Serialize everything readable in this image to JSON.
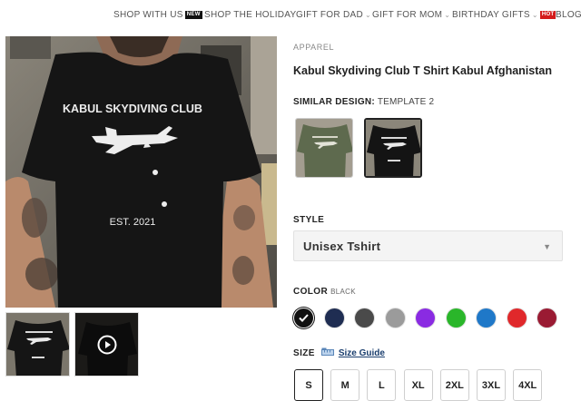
{
  "nav": {
    "items": [
      {
        "label": "SHOP WITH US",
        "badge": "NEW"
      },
      {
        "label": "SHOP THE HOLIDAY"
      },
      {
        "label": "GIFT FOR DAD",
        "chevron": "chevron-down-icon"
      },
      {
        "label": "GIFT FOR MOM",
        "chevron": "chevron-down-icon"
      },
      {
        "label": "BIRTHDAY GIFTS",
        "chevron": "chevron-down-icon",
        "badge": "HOT"
      },
      {
        "label": "BLOG"
      }
    ]
  },
  "product": {
    "category": "APPAREL",
    "title": "Kabul Skydiving Club T Shirt Kabul Afghanistan",
    "shirt_text_top": "KABUL SKYDIVING CLUB",
    "shirt_text_bottom": "EST. 2021",
    "similar_design_label": "SIMILAR DESIGN:",
    "similar_design_value": "TEMPLATE 2",
    "style_label": "STYLE",
    "style_value": "Unisex Tshirt",
    "color_label": "COLOR",
    "color_value": "BLACK",
    "colors": [
      "#111111",
      "#1f2d52",
      "#4a4a4a",
      "#9b9b9b",
      "#8a2be2",
      "#2ab62a",
      "#1f78c8",
      "#e0282b",
      "#9a1b33"
    ],
    "size_label": "SIZE",
    "size_guide": "Size Guide",
    "sizes": [
      "S",
      "M",
      "L",
      "XL",
      "2XL",
      "3XL",
      "4XL"
    ],
    "selected_size": "S"
  },
  "icons": {
    "play": "play-icon",
    "check": "check-icon",
    "size_guide": "ruler-icon",
    "select_caret": "caret-down-icon"
  }
}
